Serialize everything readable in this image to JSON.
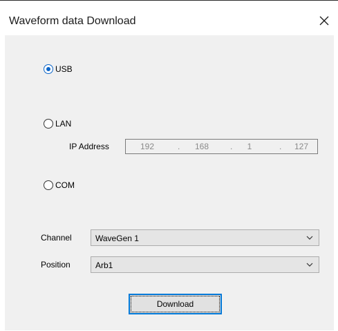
{
  "window": {
    "title": "Waveform data Download",
    "close_icon": "close-icon"
  },
  "connection": {
    "options": [
      {
        "label": "USB",
        "checked": true
      },
      {
        "label": "LAN",
        "checked": false
      },
      {
        "label": "COM",
        "checked": false
      }
    ],
    "ip_address": {
      "label": "IP Address",
      "octets": [
        "192",
        "168",
        "1",
        "127"
      ],
      "separator": "."
    }
  },
  "channel": {
    "label": "Channel",
    "selected": "WaveGen 1"
  },
  "position": {
    "label": "Position",
    "selected": "Arb1"
  },
  "actions": {
    "download_label": "Download"
  },
  "colors": {
    "accent": "#0078d7",
    "client_bg": "#f0f0f0"
  }
}
